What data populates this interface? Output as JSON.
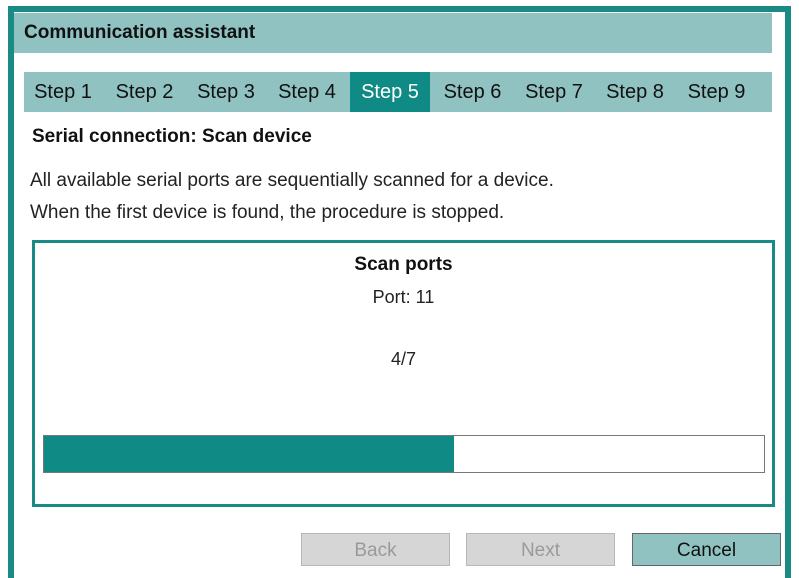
{
  "window": {
    "title": "Communication assistant"
  },
  "steps": [
    {
      "label": "Step 1"
    },
    {
      "label": "Step 2"
    },
    {
      "label": "Step 3"
    },
    {
      "label": "Step 4"
    },
    {
      "label": "Step 5",
      "active": true
    },
    {
      "label": "Step 6"
    },
    {
      "label": "Step 7"
    },
    {
      "label": "Step 8"
    },
    {
      "label": "Step 9"
    }
  ],
  "section": {
    "title": "Serial connection: Scan device",
    "description_line1": "All available serial ports are sequentially scanned for a device.",
    "description_line2": "When the first device is found, the procedure is stopped."
  },
  "scan": {
    "title": "Scan ports",
    "port": "Port: 11",
    "count": "4/7",
    "progress_fraction": 0.57
  },
  "buttons": {
    "back_label": "Back",
    "next_label": "Next",
    "cancel_label": "Cancel"
  },
  "colors": {
    "accent": "#0f8a85",
    "header_bg": "#8fc2c1"
  }
}
